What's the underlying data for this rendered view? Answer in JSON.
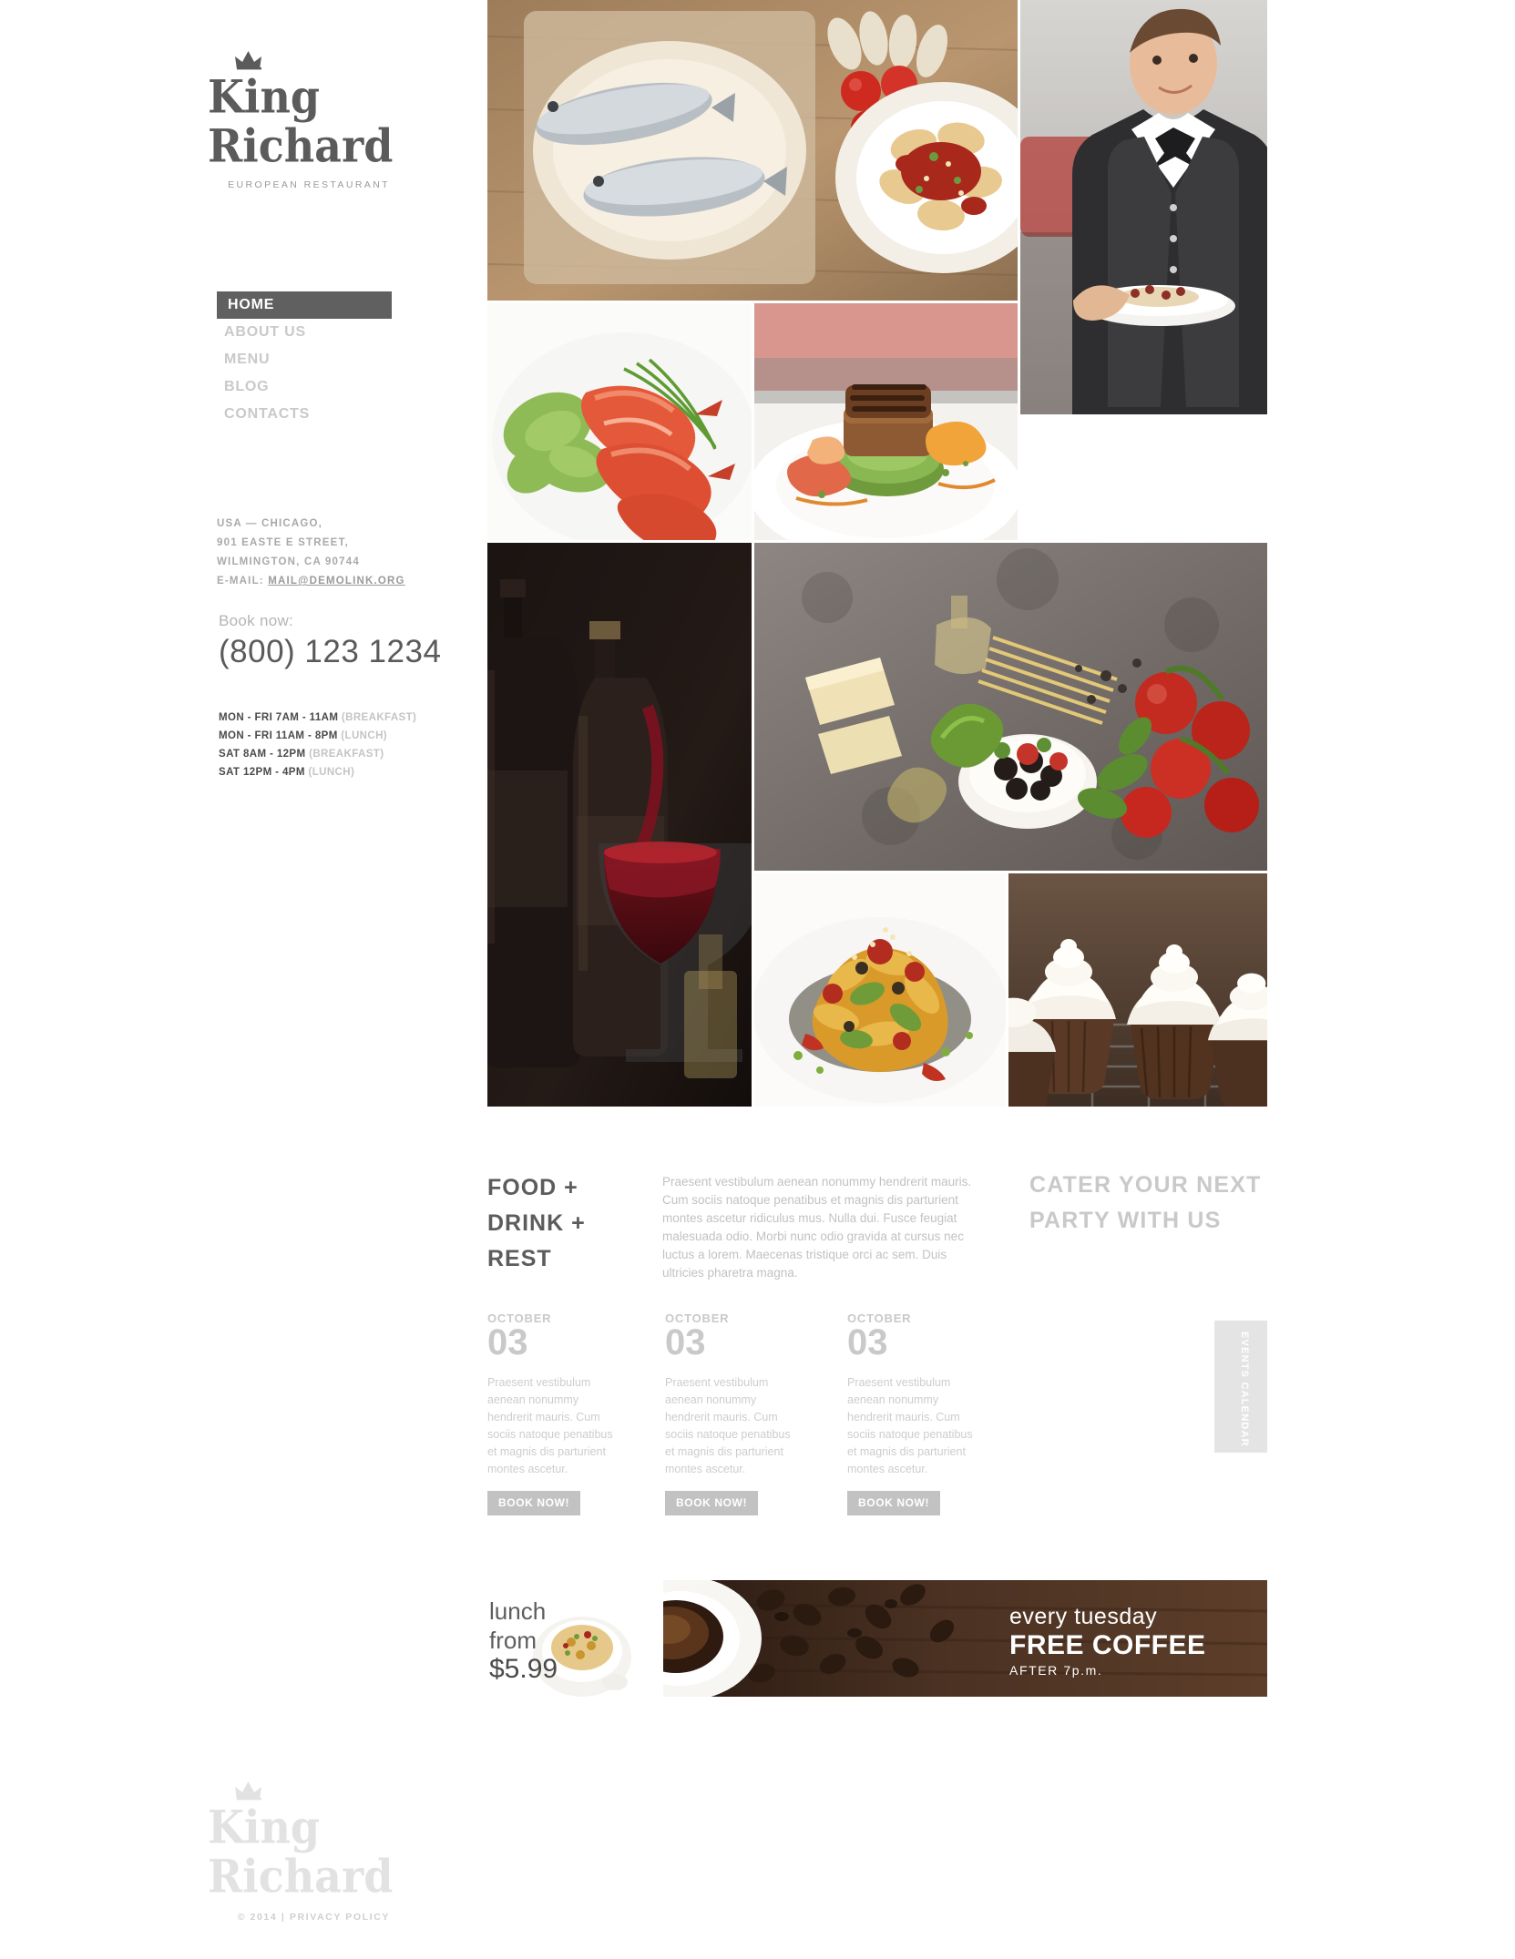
{
  "brand": {
    "line1": "King",
    "line2": "Richard",
    "tagline": "EUROPEAN RESTAURANT",
    "crown_icon": "crown-icon"
  },
  "nav": {
    "items": [
      {
        "label": "HOME",
        "active": true
      },
      {
        "label": "ABOUT US",
        "active": false
      },
      {
        "label": "MENU",
        "active": false
      },
      {
        "label": "BLOG",
        "active": false
      },
      {
        "label": "CONTACTS",
        "active": false
      }
    ]
  },
  "address": {
    "line1": "USA — CHICAGO,",
    "line2": "901 EASTE E STREET,",
    "line3": "WILMINGTON, CA 90744",
    "email_label": "E-MAIL:",
    "email": "MAIL@DEMOLINK.ORG"
  },
  "booking": {
    "label": "Book now:",
    "phone": "(800) 123 1234"
  },
  "hours": [
    {
      "time": "MON - FRI 7AM - 11AM",
      "meal": "(BREAKFAST)"
    },
    {
      "time": "MON - FRI 11AM - 8PM",
      "meal": "(LUNCH)"
    },
    {
      "time": "SAT 8AM - 12PM",
      "meal": "(BREAKFAST)"
    },
    {
      "time": "SAT 12PM - 4PM",
      "meal": "(LUNCH)"
    }
  ],
  "gallery": [
    {
      "name": "gallery-fish-pasta",
      "alt": "two grilled fish on plate with pasta"
    },
    {
      "name": "gallery-waiter",
      "alt": "waiter in bow tie holding plate"
    },
    {
      "name": "gallery-shrimp-salad",
      "alt": "shrimp on lettuce with chives"
    },
    {
      "name": "gallery-steak-tower",
      "alt": "grilled meat stack on green vegetable"
    },
    {
      "name": "gallery-wine-bottles",
      "alt": "wine bottles and glass of red wine"
    },
    {
      "name": "gallery-ingredients",
      "alt": "tomatoes herbs spaghetti on stone board"
    },
    {
      "name": "gallery-vegetable-dish",
      "alt": "roasted vegetable tower plated"
    },
    {
      "name": "gallery-cupcakes",
      "alt": "chocolate cupcakes with white frosting"
    }
  ],
  "main": {
    "heading_food": "FOOD + DRINK + REST",
    "lead": "Praesent vestibulum aenean nonummy hendrerit mauris. Cum sociis natoque penatibus et magnis dis parturient montes ascetur ridiculus mus. Nulla dui. Fusce feugiat malesuada odio. Morbi nunc odio gravida at cursus nec luctus a lorem. Maecenas tristique orci ac sem. Duis ultricies pharetra magna.",
    "heading_cater": "CATER YOUR NEXT PARTY WITH US"
  },
  "events": {
    "calendar_tab": "EVENTS CALENDAR",
    "items": [
      {
        "month": "OCTOBER",
        "day": "03",
        "text": "Praesent vestibulum aenean nonummy hendrerit mauris. Cum sociis natoque penatibus et magnis dis parturient montes ascetur.",
        "button": "BOOK NOW!"
      },
      {
        "month": "OCTOBER",
        "day": "03",
        "text": "Praesent vestibulum aenean nonummy hendrerit mauris. Cum sociis natoque penatibus et magnis dis parturient montes ascetur.",
        "button": "BOOK NOW!"
      },
      {
        "month": "OCTOBER",
        "day": "03",
        "text": "Praesent vestibulum aenean nonummy hendrerit mauris. Cum sociis natoque penatibus et magnis dis parturient montes ascetur.",
        "button": "BOOK NOW!"
      }
    ]
  },
  "banner": {
    "lunch_l1": "lunch",
    "lunch_l2": "from",
    "lunch_price": "$5.99",
    "coffee_l1": "every tuesday",
    "coffee_l2": "FREE COFFEE",
    "coffee_l3": "AFTER  7p.m."
  },
  "footer": {
    "copyright": "© 2014  |  PRIVACY POLICY"
  },
  "colors": {
    "ink": "#5b5b5b",
    "muted": "#c9c9c9",
    "nav_active_bg": "#606060",
    "button_bg": "#c2c2c2",
    "tab_bg": "#e4e4e4"
  }
}
